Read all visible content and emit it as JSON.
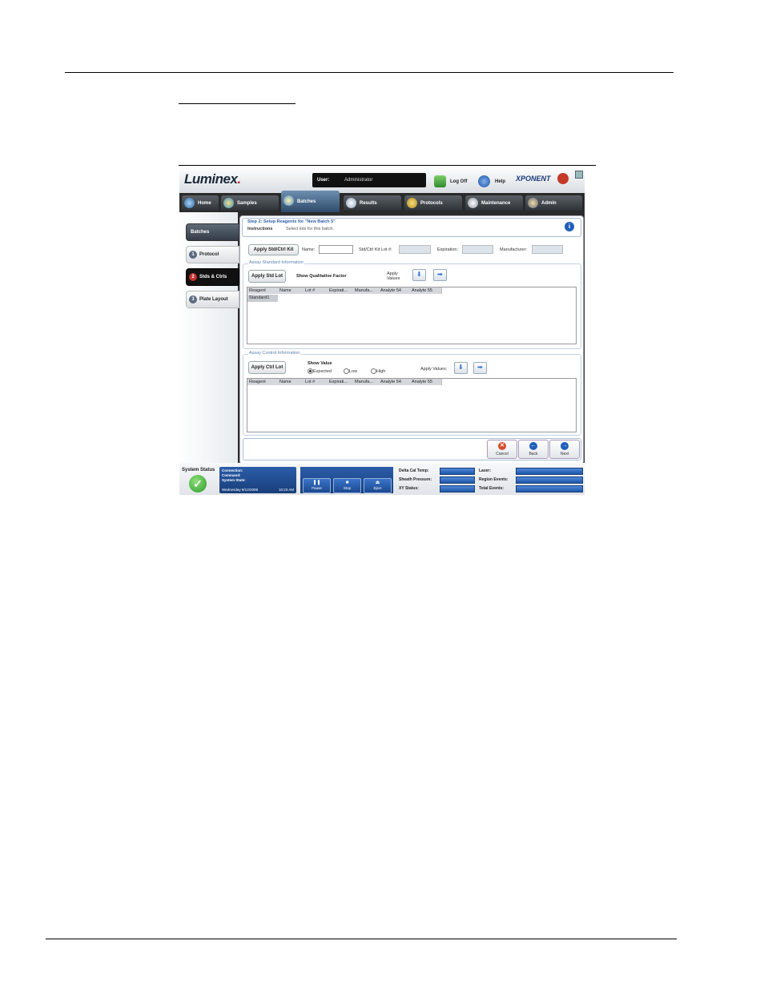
{
  "app": {
    "logo": "Luminex",
    "user_label": "User:",
    "user_value": "Administrator",
    "logoff_label": "Log Off",
    "help_label": "Help",
    "brand": "XPONENT"
  },
  "nav": {
    "tabs": [
      {
        "label": "Home"
      },
      {
        "label": "Samples"
      },
      {
        "label": "Batches"
      },
      {
        "label": "Results"
      },
      {
        "label": "Protocols"
      },
      {
        "label": "Maintenance"
      },
      {
        "label": "Admin"
      }
    ]
  },
  "sidebar": {
    "items": [
      {
        "label": "Batches"
      },
      {
        "num": "1",
        "label": "Protocol"
      },
      {
        "num": "2",
        "label": "Stds & Ctrls"
      },
      {
        "num": "3",
        "label": "Plate Layout"
      }
    ]
  },
  "step": {
    "title": "Step 2: Setup Reagents for \"New Batch 5\"",
    "instructions_label": "Instructions",
    "instructions_text": "Select lots for this batch."
  },
  "kit": {
    "apply_button": "Apply Std/Ctrl Kit",
    "name_label": "Name:",
    "lot_label": "Std/Ctrl Kit Lot #:",
    "expiration_label": "Expiration:",
    "manufacturer_label": "Manufacturer:"
  },
  "standard": {
    "group_title": "Assay Standard Information",
    "apply_lot_button": "Apply Std Lot",
    "show_factor_label": "Show Qualitative Factor",
    "apply_values_label": "Apply Values",
    "columns": [
      "Reagent",
      "Name",
      "Lot #",
      "Expirati...",
      "Manufa...",
      "Analyte 54",
      "Analyte 55"
    ],
    "rows": [
      [
        "Standard1"
      ]
    ]
  },
  "control": {
    "group_title": "Assay Control Information",
    "apply_lot_button": "Apply Ctrl Lot",
    "show_value_label": "Show Value",
    "radio_expected": "Expected",
    "radio_low": "Low",
    "radio_high": "High",
    "selected": "Expected",
    "apply_values_label": "Apply Values:",
    "columns": [
      "Reagent",
      "Name",
      "Lot #",
      "Expirati...",
      "Manufa...",
      "Analyte 54",
      "Analyte 55"
    ]
  },
  "footer_buttons": {
    "cancel": "Cancel",
    "back": "Back",
    "next": "Next"
  },
  "status": {
    "title": "System Status",
    "connection_label": "Connection:",
    "command_label": "Command:",
    "state_label": "System State:",
    "date": "Wednesday 8/12/2009",
    "time": "10:23 AM",
    "pause": "Pause",
    "stop": "Stop",
    "eject": "Eject",
    "delta_cal_temp": "Delta Cal Temp:",
    "sheath_pressure": "Sheath Pressure:",
    "xy_status": "XY Status:",
    "laser": "Laser:",
    "region_events": "Region Events:",
    "total_events": "Total Events:"
  },
  "colors": {
    "accent": "#2f6fd0",
    "selected_tab": "#c0302c",
    "status_ok": "#2a9a2a"
  }
}
